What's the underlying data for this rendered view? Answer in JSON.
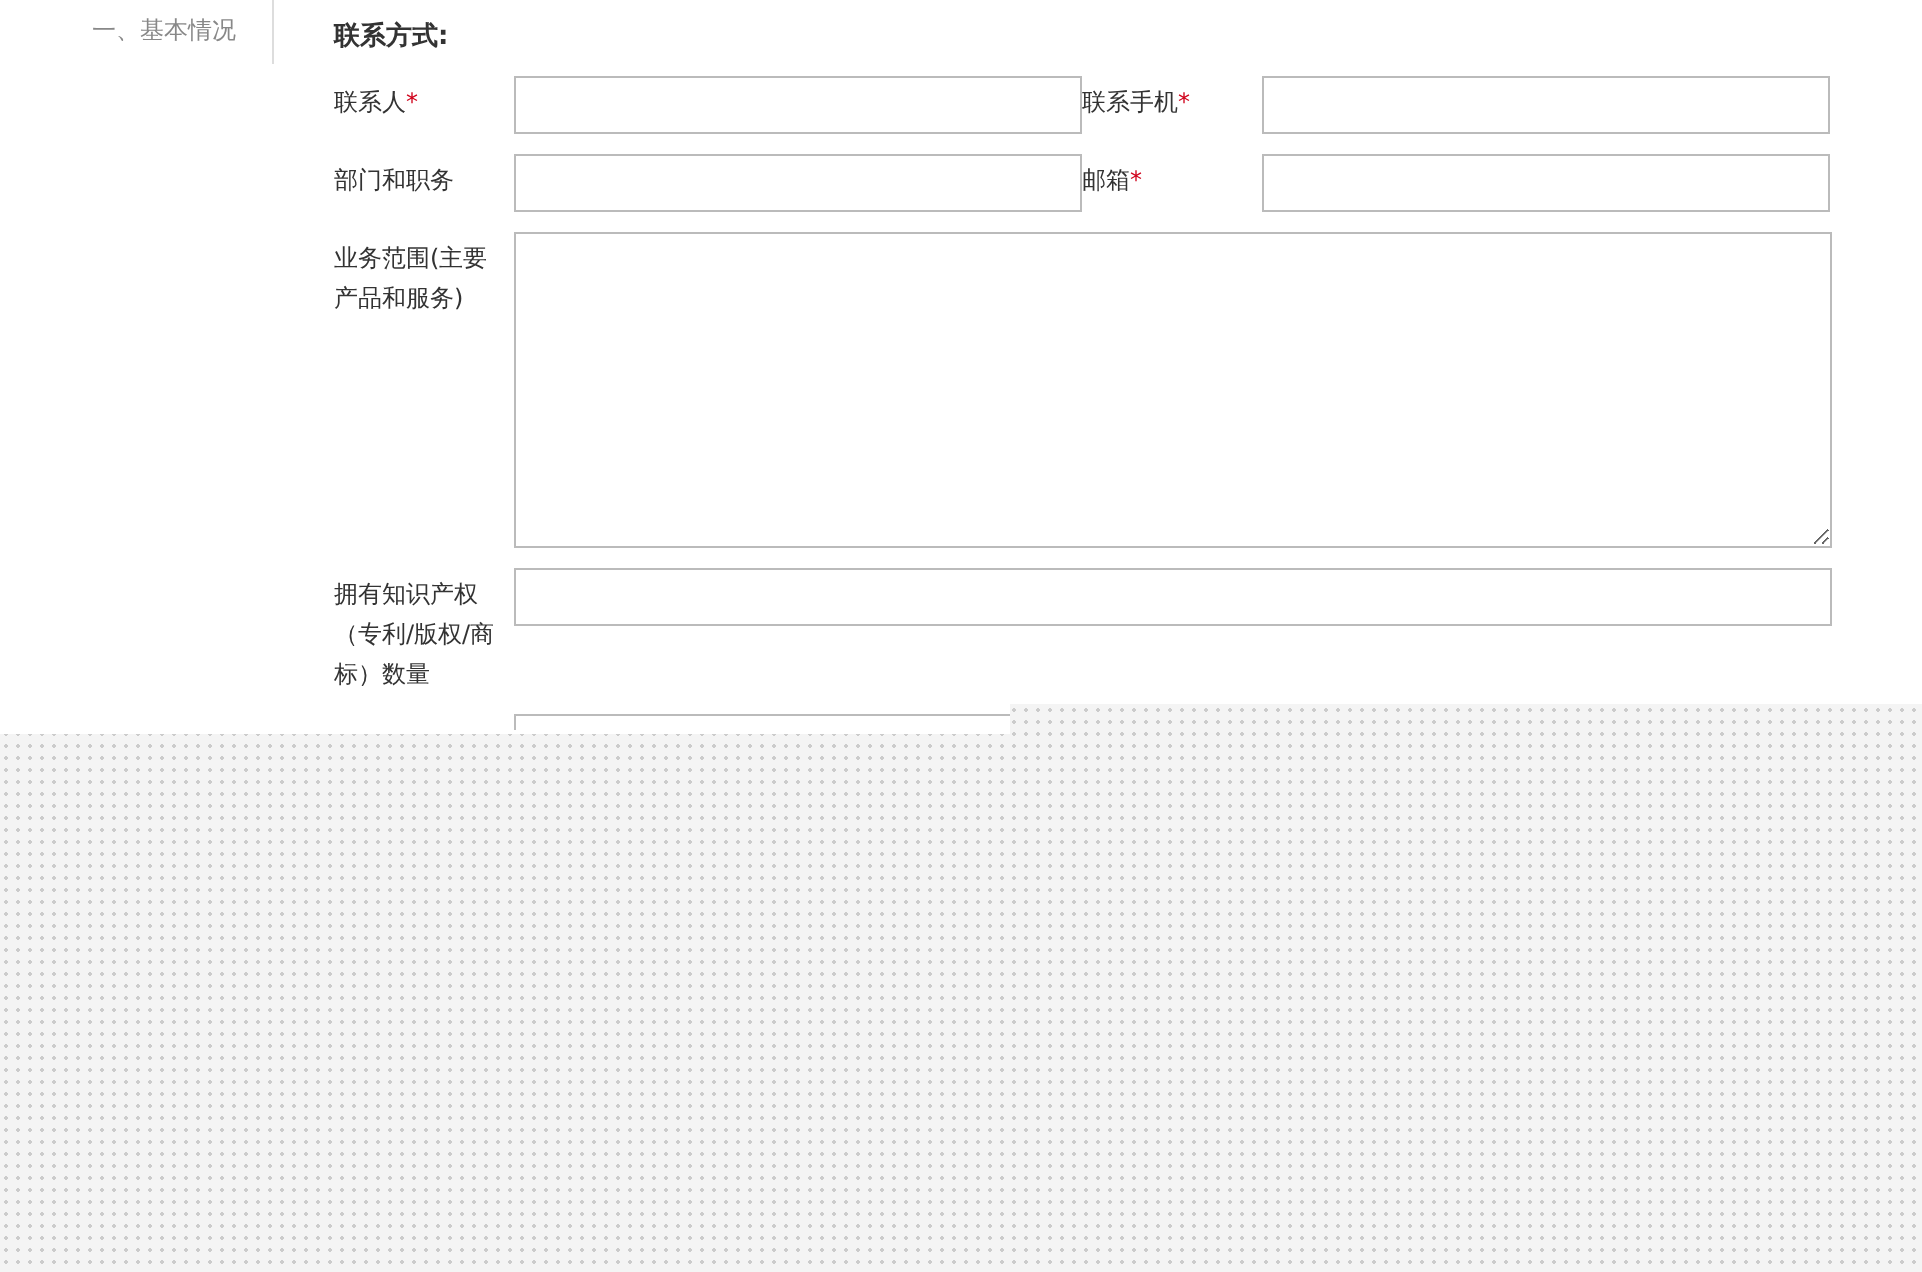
{
  "sidebar": {
    "items": [
      {
        "label": "一、基本情况",
        "selected": false
      }
    ]
  },
  "section": {
    "title": "联系方式:"
  },
  "rows": [
    {
      "fields": [
        {
          "label": "联系人",
          "required_mark": "*",
          "kind": "input"
        },
        {
          "label": "联系手机",
          "required_mark": "*",
          "kind": "input"
        }
      ]
    },
    {
      "fields": [
        {
          "label": "部门和职务",
          "kind": "input"
        },
        {
          "label": "邮箱",
          "required_mark": "*",
          "kind": "input"
        }
      ]
    },
    {
      "fields": [
        {
          "label": "业务范围(主要产品和服务)",
          "kind": "textarea"
        }
      ]
    },
    {
      "fields": [
        {
          "label": "拥有知识产权（专利/版权/商标）数量",
          "kind": "input"
        }
      ]
    },
    {
      "fields": [
        {
          "kind": "input"
        }
      ]
    }
  ]
}
